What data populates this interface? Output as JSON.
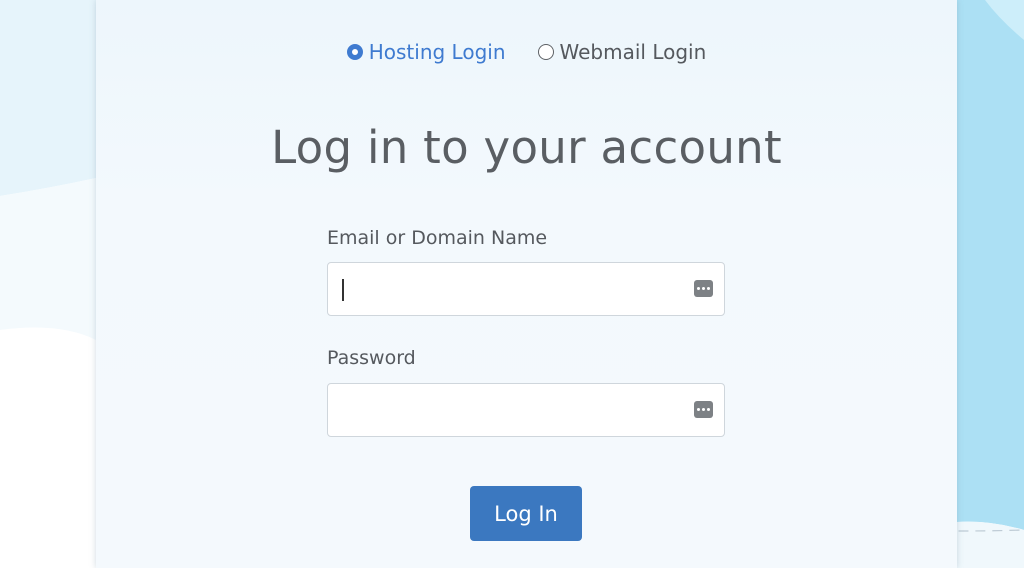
{
  "login_type": {
    "options": [
      {
        "label": "Hosting Login",
        "selected": true
      },
      {
        "label": "Webmail Login",
        "selected": false
      }
    ]
  },
  "title": "Log in to your account",
  "form": {
    "email": {
      "label": "Email or Domain Name",
      "value": ""
    },
    "password": {
      "label": "Password",
      "value": ""
    },
    "submit_label": "Log In"
  },
  "colors": {
    "accent": "#3f7bd0",
    "button": "#3b78c0",
    "text": "#55595e"
  },
  "icons": {
    "field_autofill": "password-manager-icon"
  }
}
